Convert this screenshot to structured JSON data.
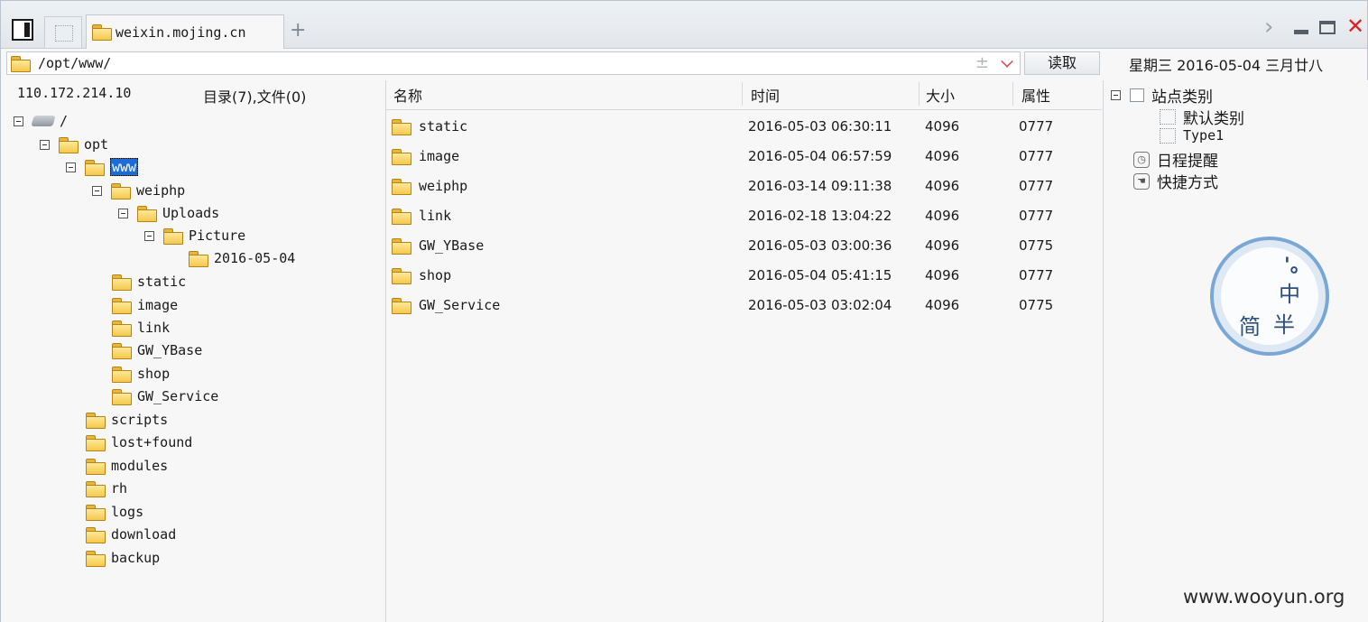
{
  "tabs": {
    "active_title": "weixin.mojing.cn",
    "add": "+"
  },
  "window_controls": {
    "chevron": "›",
    "close": "✕"
  },
  "address": {
    "path": "/opt/www/",
    "plusminus": "±",
    "read_label": "读取",
    "date": "星期三  2016-05-04  三月廿八"
  },
  "left": {
    "server": "110.172.214.10",
    "counts": "目录(7),文件(0)",
    "tree": [
      {
        "label": "/",
        "depth": 0,
        "expander": true,
        "type": "drive"
      },
      {
        "label": "opt",
        "depth": 1,
        "expander": true
      },
      {
        "label": "www",
        "depth": 2,
        "expander": true,
        "selected": true
      },
      {
        "label": "weiphp",
        "depth": 3,
        "expander": true
      },
      {
        "label": "Uploads",
        "depth": 4,
        "expander": true
      },
      {
        "label": "Picture",
        "depth": 5,
        "expander": true
      },
      {
        "label": "2016-05-04",
        "depth": 6,
        "expander": false
      },
      {
        "label": "static",
        "depth": 3,
        "expander": false
      },
      {
        "label": "image",
        "depth": 3,
        "expander": false
      },
      {
        "label": "link",
        "depth": 3,
        "expander": false
      },
      {
        "label": "GW_YBase",
        "depth": 3,
        "expander": false
      },
      {
        "label": "shop",
        "depth": 3,
        "expander": false
      },
      {
        "label": "GW_Service",
        "depth": 3,
        "expander": false
      },
      {
        "label": "scripts",
        "depth": 2,
        "expander": false
      },
      {
        "label": "lost+found",
        "depth": 2,
        "expander": false
      },
      {
        "label": "modules",
        "depth": 2,
        "expander": false
      },
      {
        "label": "rh",
        "depth": 2,
        "expander": false
      },
      {
        "label": "logs",
        "depth": 2,
        "expander": false
      },
      {
        "label": "download",
        "depth": 2,
        "expander": false
      },
      {
        "label": "backup",
        "depth": 2,
        "expander": false
      }
    ]
  },
  "files": {
    "columns": {
      "name": "名称",
      "time": "时间",
      "size": "大小",
      "attr": "属性"
    },
    "rows": [
      {
        "name": "static",
        "time": "2016-05-03 06:30:11",
        "size": "4096",
        "attr": "0777"
      },
      {
        "name": "image",
        "time": "2016-05-04 06:57:59",
        "size": "4096",
        "attr": "0777"
      },
      {
        "name": "weiphp",
        "time": "2016-03-14 09:11:38",
        "size": "4096",
        "attr": "0777"
      },
      {
        "name": "link",
        "time": "2016-02-18 13:04:22",
        "size": "4096",
        "attr": "0777"
      },
      {
        "name": "GW_YBase",
        "time": "2016-05-03 03:00:36",
        "size": "4096",
        "attr": "0775"
      },
      {
        "name": "shop",
        "time": "2016-05-04 05:41:15",
        "size": "4096",
        "attr": "0777"
      },
      {
        "name": "GW_Service",
        "time": "2016-05-03 03:02:04",
        "size": "4096",
        "attr": "0775"
      }
    ]
  },
  "right": {
    "site_category": "站点类别",
    "default_category": "默认类别",
    "type1": "Type1",
    "schedule": "日程提醒",
    "shortcut": "快捷方式",
    "ime": {
      "zhong": "中",
      "jian": "简",
      "ban": "半",
      "punct": "'。"
    }
  },
  "watermark": "www.wooyun.org",
  "colors": {
    "selection": "#1e6bd6",
    "close": "#e02020",
    "folder": "#f5c84b",
    "ime_ring": "#7aa7d6"
  }
}
